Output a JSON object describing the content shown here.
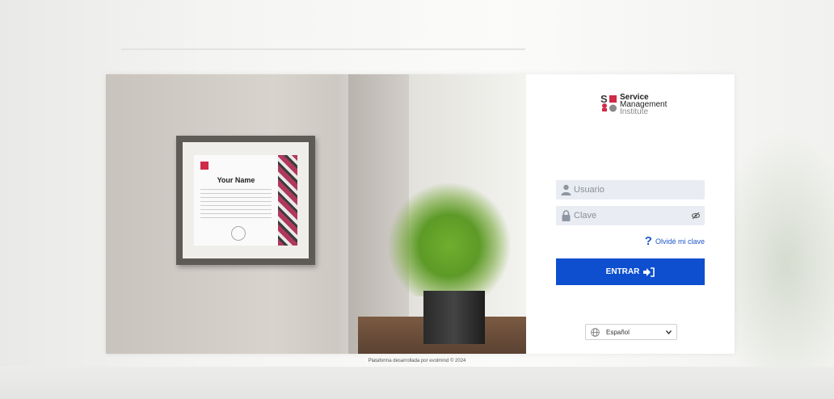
{
  "brand": {
    "line1": "Service",
    "line2": "Management",
    "line3": "Institute",
    "accent": "#d02b47",
    "dark": "#3a3a3a"
  },
  "certificate": {
    "name": "Your Name"
  },
  "login": {
    "username_placeholder": "Usuario",
    "password_placeholder": "Clave",
    "forgot_label": "Olvidé mi clave",
    "submit_label": "ENTRAR",
    "submit_color": "#0d4fcf",
    "icons": {
      "user": "user-icon",
      "lock": "lock-icon",
      "eye": "eye-icon",
      "help": "question-icon",
      "login": "sign-in-icon",
      "globe": "globe-icon",
      "chevron": "chevron-down-icon"
    }
  },
  "language": {
    "selected": "Español"
  },
  "footer": {
    "text": "Plataforma desarrollada por evolmind © 2024"
  }
}
